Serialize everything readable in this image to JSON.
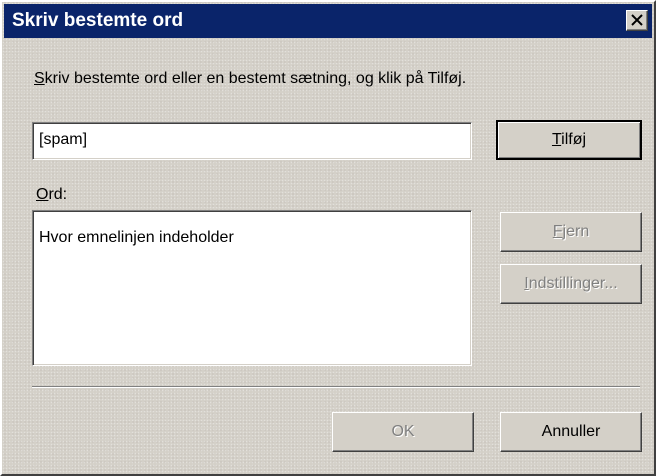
{
  "window": {
    "title": "Skriv bestemte ord"
  },
  "instruction": {
    "mnemonic": "S",
    "rest": "kriv bestemte ord eller en bestemt sætning, og klik på Tilføj."
  },
  "input": {
    "value": "[spam]"
  },
  "list": {
    "label_mnemonic": "O",
    "label_rest": "rd:",
    "items": [
      "Hvor emnelinjen indeholder"
    ]
  },
  "buttons": {
    "add": {
      "mnemonic": "T",
      "rest": "ilføj",
      "enabled": true
    },
    "remove": {
      "mnemonic": "F",
      "rest": "jern",
      "enabled": false
    },
    "settings": {
      "mnemonic": "I",
      "rest": "ndstillinger...",
      "enabled": false
    },
    "ok": {
      "label": "OK",
      "enabled": false
    },
    "cancel": {
      "label": "Annuller",
      "enabled": true
    }
  },
  "colors": {
    "titlebar": "#0a246a",
    "dialog_face": "#d4d0c8",
    "disabled_text": "#808080"
  },
  "icons": {
    "close": "close-icon"
  }
}
